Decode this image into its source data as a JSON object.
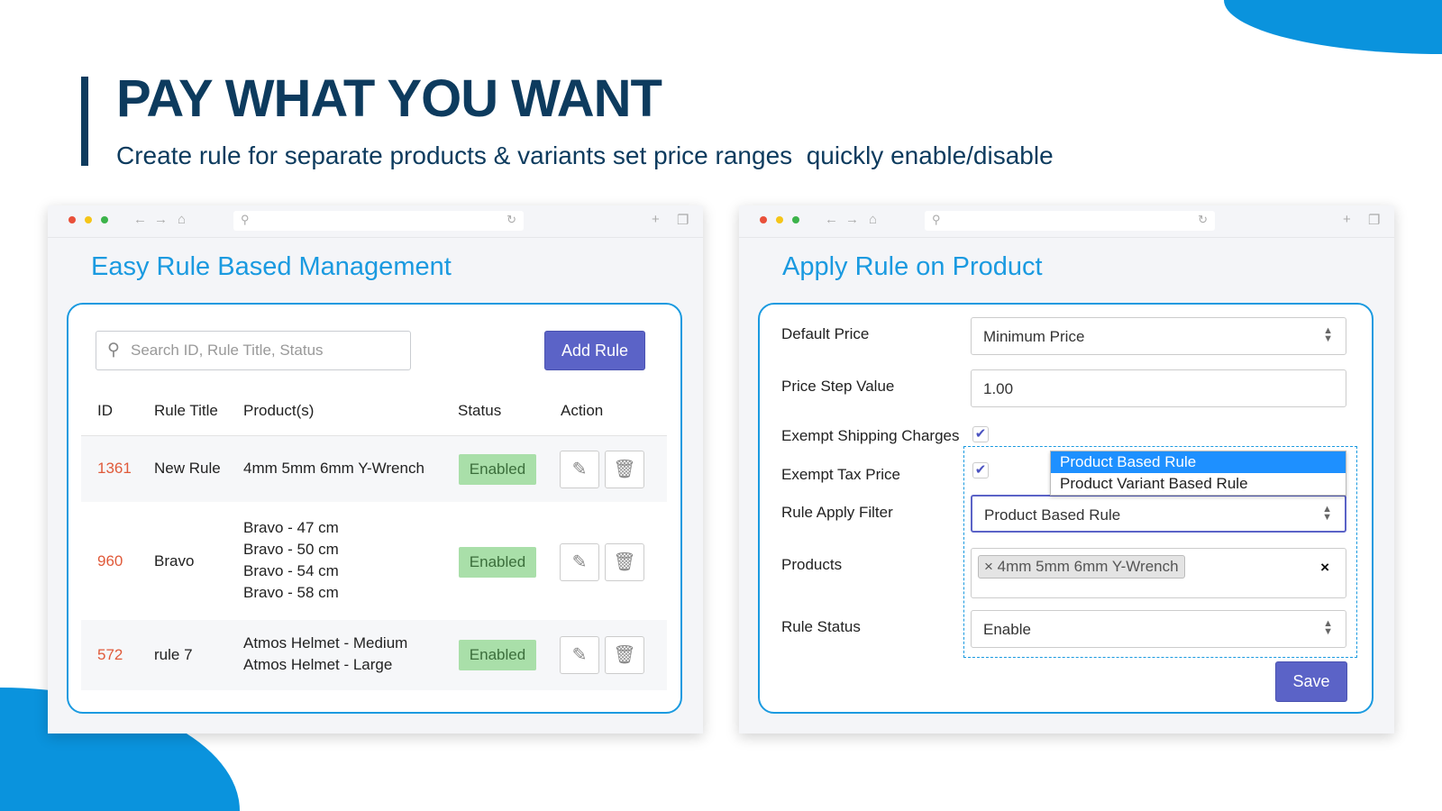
{
  "header": {
    "title": "PAY WHAT YOU WANT",
    "subtitle": "Create rule for separate products & variants set price ranges  quickly enable/disable"
  },
  "left": {
    "title": "Easy Rule Based Management",
    "search_placeholder": "Search ID, Rule Title, Status",
    "add_rule": "Add Rule",
    "columns": [
      "ID",
      "Rule Title",
      "Product(s)",
      "Status",
      "Action"
    ],
    "rows": [
      {
        "id": "1361",
        "title": "New Rule",
        "products": [
          "4mm 5mm 6mm Y-Wrench"
        ],
        "status": "Enabled"
      },
      {
        "id": "960",
        "title": "Bravo",
        "products": [
          "Bravo - 47 cm",
          "Bravo - 50 cm",
          "Bravo - 54 cm",
          "Bravo - 58 cm"
        ],
        "status": "Enabled"
      },
      {
        "id": "572",
        "title": "rule 7",
        "products": [
          "Atmos Helmet - Medium",
          "Atmos Helmet - Large"
        ],
        "status": "Enabled"
      }
    ]
  },
  "right": {
    "title": "Apply Rule on Product",
    "default_price_label": "Default Price",
    "default_price": "Minimum Price",
    "step_label": "Price Step Value",
    "step": "1.00",
    "shipping_label": "Exempt Shipping Charges",
    "shipping_checked": true,
    "tax_label": "Exempt Tax Price",
    "tax_checked": true,
    "filter_label": "Rule Apply Filter",
    "filter": "Product Based Rule",
    "filter_options": [
      "Product Based Rule",
      "Product Variant Based Rule"
    ],
    "products_label": "Products",
    "product_tag": "4mm 5mm 6mm Y-Wrench",
    "status_label": "Rule Status",
    "status": "Enable",
    "save": "Save"
  },
  "colors": {
    "navy": "#0d3b5e",
    "accent": "#1a9ae0",
    "button": "#5b63c7",
    "badge": "#a9dfa9",
    "id": "#e05a3a",
    "highlight": "#1e90ff"
  }
}
